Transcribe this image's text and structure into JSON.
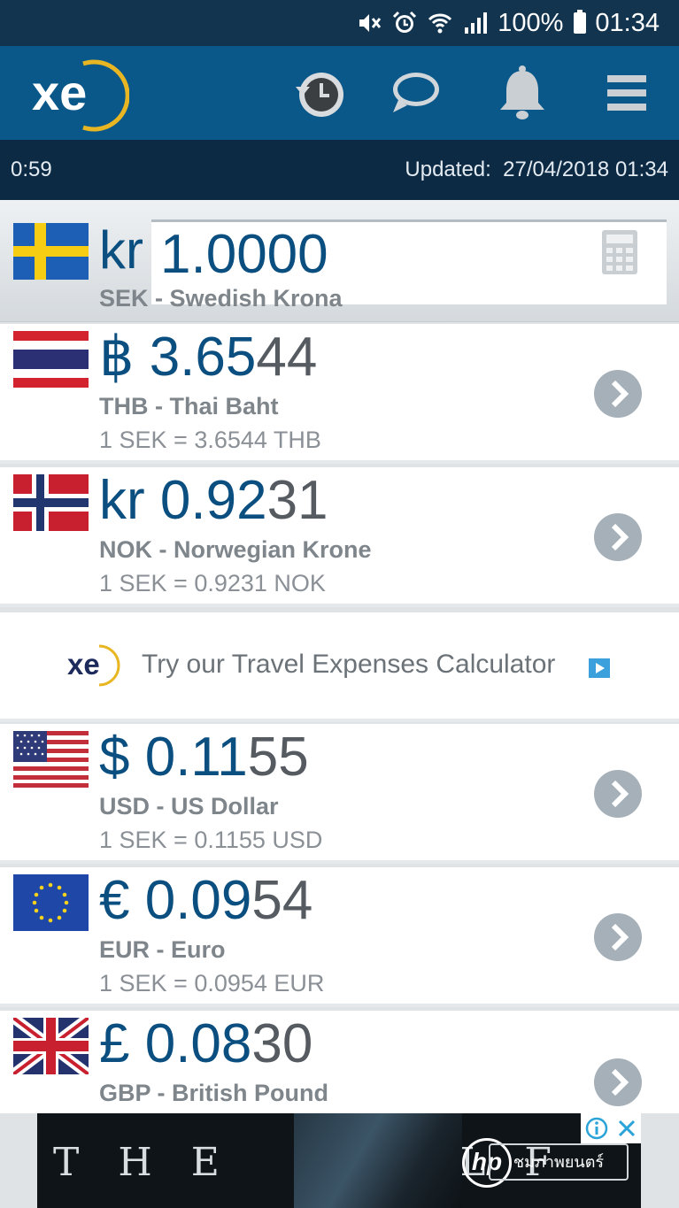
{
  "status_bar": {
    "battery": "100%",
    "time": "01:34",
    "icons": [
      "mute-icon",
      "alarm-icon",
      "wifi-icon",
      "signal-icon",
      "battery-icon"
    ]
  },
  "header": {
    "logo_text": "xe",
    "actions": [
      "history-icon",
      "chat-icon",
      "alert-bell-icon",
      "menu-icon"
    ]
  },
  "update_bar": {
    "timer": "0:59",
    "updated_label": "Updated:",
    "updated_value": "27/04/2018 01:34"
  },
  "base": {
    "symbol": "kr",
    "amount": "1.0000",
    "name": "SEK - Swedish Krona"
  },
  "rows": [
    {
      "symbol": "฿",
      "value_main": "3.65",
      "value_dim": "44",
      "name": "THB - Thai Baht",
      "rate": "1 SEK = 3.6544 THB"
    },
    {
      "symbol": "kr",
      "value_main": "0.92",
      "value_dim": "31",
      "name": "NOK - Norwegian Krone",
      "rate": "1 SEK = 0.9231 NOK"
    },
    {
      "symbol": "$",
      "value_main": "0.11",
      "value_dim": "55",
      "name": "USD - US Dollar",
      "rate": "1 SEK = 0.1155 USD"
    },
    {
      "symbol": "€",
      "value_main": "0.09",
      "value_dim": "54",
      "name": "EUR - Euro",
      "rate": "1 SEK = 0.0954 EUR"
    },
    {
      "symbol": "£",
      "value_main": "0.08",
      "value_dim": "30",
      "name": "GBP - British Pound",
      "rate": ""
    }
  ],
  "promo": {
    "logo_text": "xe",
    "text": "Try our Travel Expenses Calculator"
  },
  "ad": {
    "headline": "THE WOLF",
    "brand": "hp",
    "cta": "ชมภาพยนตร์"
  },
  "colors": {
    "status_bar": "#12344f",
    "app_bar": "#0a5789",
    "update_bar": "#0d2a45",
    "amount_blue": "#0b4f80",
    "logo_gold": "#e8b623"
  }
}
